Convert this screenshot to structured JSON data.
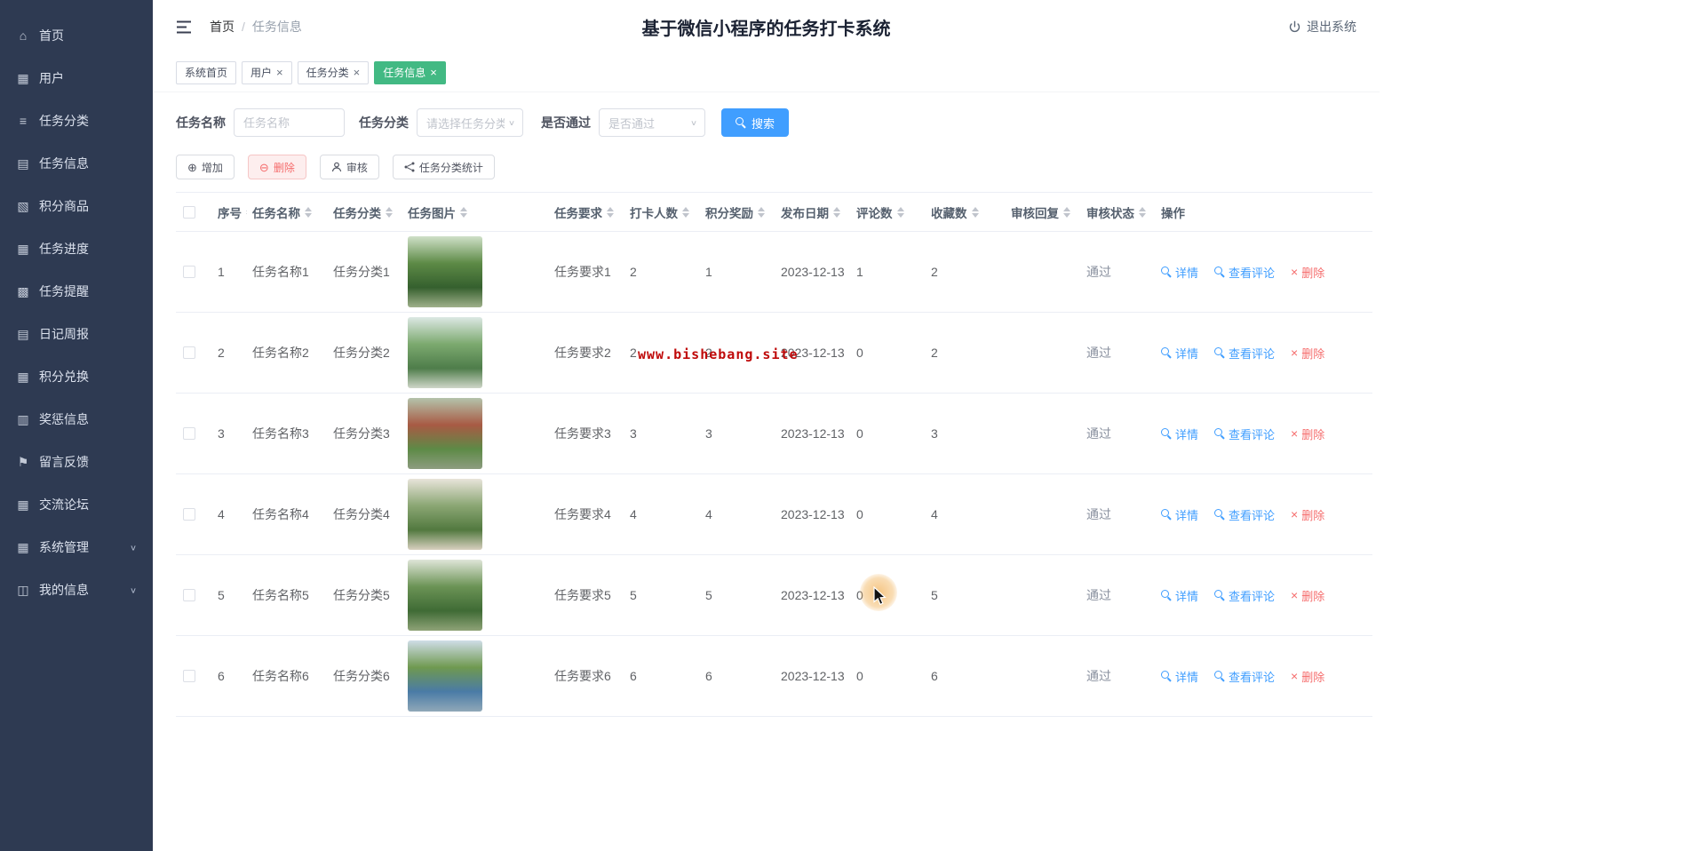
{
  "app": {
    "title": "基于微信小程序的任务打卡系统",
    "logout_label": "退出系统"
  },
  "breadcrumb": {
    "home": "首页",
    "separator": "/",
    "current": "任务信息"
  },
  "sidebar": {
    "items": [
      {
        "name": "home",
        "label": "首页",
        "icon": "home-icon"
      },
      {
        "name": "users",
        "label": "用户",
        "icon": "users-icon"
      },
      {
        "name": "task-category",
        "label": "任务分类",
        "icon": "task-category-icon"
      },
      {
        "name": "task-info",
        "label": "任务信息",
        "icon": "task-info-icon"
      },
      {
        "name": "points-goods",
        "label": "积分商品",
        "icon": "points-goods-icon"
      },
      {
        "name": "task-progress",
        "label": "任务进度",
        "icon": "task-progress-icon"
      },
      {
        "name": "task-reminder",
        "label": "任务提醒",
        "icon": "task-reminder-icon"
      },
      {
        "name": "diary-report",
        "label": "日记周报",
        "icon": "diary-report-icon"
      },
      {
        "name": "points-exchange",
        "label": "积分兑换",
        "icon": "points-exchange-icon"
      },
      {
        "name": "reward-punish",
        "label": "奖惩信息",
        "icon": "reward-punish-icon"
      },
      {
        "name": "feedback",
        "label": "留言反馈",
        "icon": "feedback-icon"
      },
      {
        "name": "forum",
        "label": "交流论坛",
        "icon": "forum-icon"
      },
      {
        "name": "system-manage",
        "label": "系统管理",
        "icon": "system-manage-icon",
        "expandable": true
      },
      {
        "name": "my-info",
        "label": "我的信息",
        "icon": "my-info-icon",
        "expandable": true
      }
    ]
  },
  "tabs": [
    {
      "name": "system-home",
      "label": "系统首页",
      "closable": false,
      "active": false
    },
    {
      "name": "users",
      "label": "用户",
      "closable": true,
      "active": false
    },
    {
      "name": "task-category",
      "label": "任务分类",
      "closable": true,
      "active": false
    },
    {
      "name": "task-info",
      "label": "任务信息",
      "closable": true,
      "active": true
    }
  ],
  "filters": {
    "name_label": "任务名称",
    "name_placeholder": "任务名称",
    "name_value": "",
    "category_label": "任务分类",
    "category_placeholder": "请选择任务分类",
    "pass_label": "是否通过",
    "pass_placeholder": "是否通过",
    "search_label": "搜索"
  },
  "toolbar": {
    "add_label": "增加",
    "delete_label": "删除",
    "audit_label": "审核",
    "stats_label": "任务分类统计"
  },
  "table": {
    "columns": [
      "序号",
      "任务名称",
      "任务分类",
      "任务图片",
      "任务要求",
      "打卡人数",
      "积分奖励",
      "发布日期",
      "评论数",
      "收藏数",
      "审核回复",
      "审核状态",
      "操作"
    ],
    "action_labels": {
      "detail": "详情",
      "comments": "查看评论",
      "delete": "删除"
    },
    "rows": [
      {
        "no": "1",
        "name": "任务名称1",
        "category": "任务分类1",
        "requirement": "任务要求1",
        "checkin_count": "2",
        "points": "1",
        "date": "2023-12-13",
        "comments": "1",
        "favorites": "2",
        "review_reply": "",
        "status": "通过",
        "image_colors": [
          "#cfe0c8",
          "#5d8a46",
          "#35602e",
          "#9fb08a"
        ]
      },
      {
        "no": "2",
        "name": "任务名称2",
        "category": "任务分类2",
        "requirement": "任务要求2",
        "checkin_count": "2",
        "points": "2",
        "date": "2023-12-13",
        "comments": "0",
        "favorites": "2",
        "review_reply": "",
        "status": "通过",
        "image_colors": [
          "#dce8e4",
          "#7ca96f",
          "#4e7d4a",
          "#cfd6c8"
        ]
      },
      {
        "no": "3",
        "name": "任务名称3",
        "category": "任务分类3",
        "requirement": "任务要求3",
        "checkin_count": "3",
        "points": "3",
        "date": "2023-12-13",
        "comments": "0",
        "favorites": "3",
        "review_reply": "",
        "status": "通过",
        "image_colors": [
          "#b4c3ab",
          "#a85a44",
          "#5d8a46",
          "#8d9c80"
        ]
      },
      {
        "no": "4",
        "name": "任务名称4",
        "category": "任务分类4",
        "requirement": "任务要求4",
        "checkin_count": "4",
        "points": "4",
        "date": "2023-12-13",
        "comments": "0",
        "favorites": "4",
        "review_reply": "",
        "status": "通过",
        "image_colors": [
          "#e8e4da",
          "#8aa673",
          "#52793f",
          "#d8d0bf"
        ]
      },
      {
        "no": "5",
        "name": "任务名称5",
        "category": "任务分类5",
        "requirement": "任务要求5",
        "checkin_count": "5",
        "points": "5",
        "date": "2023-12-13",
        "comments": "0",
        "favorites": "5",
        "review_reply": "",
        "status": "通过",
        "image_colors": [
          "#dfe5d8",
          "#6b9355",
          "#3f6b35",
          "#8fa378"
        ]
      },
      {
        "no": "6",
        "name": "任务名称6",
        "category": "任务分类6",
        "requirement": "任务要求6",
        "checkin_count": "6",
        "points": "6",
        "date": "2023-12-13",
        "comments": "0",
        "favorites": "6",
        "review_reply": "",
        "status": "通过",
        "image_colors": [
          "#cfdde8",
          "#6f9950",
          "#4a7ba6",
          "#90a8b8"
        ]
      }
    ]
  },
  "watermark": "www.bishebang.site",
  "colors": {
    "sidebar_bg": "#2e3a52",
    "active_tab_green": "#42b983",
    "primary_blue": "#409eff",
    "danger_red": "#f56c6c",
    "watermark_red": "#bf0a0a"
  }
}
